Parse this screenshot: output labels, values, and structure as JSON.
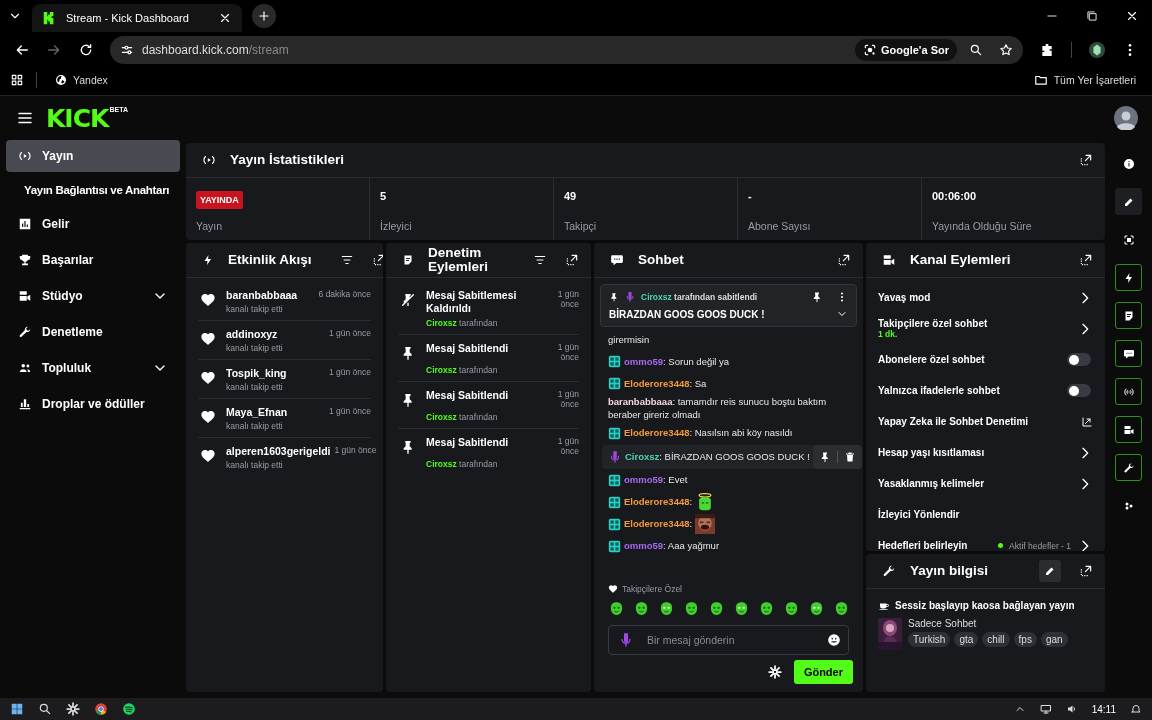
{
  "browser": {
    "tab_title": "Stream - Kick Dashboard",
    "url_host": "dashboard.kick.com",
    "url_path": "/stream",
    "ask_button": "Google'a Sor",
    "bookmarks": [
      "Yandex"
    ],
    "all_bookmarks": "Tüm Yer İşaretleri"
  },
  "header": {
    "logo": "KICK",
    "logo_tag": "BETA"
  },
  "sidebar": {
    "items": [
      {
        "label": "Yayın",
        "selected": true,
        "children": [
          {
            "label": "Yayın Bağlantısı ve Anahtarı",
            "selected": false
          }
        ]
      },
      {
        "label": "Gelir",
        "selected": false
      },
      {
        "label": "Başarılar",
        "selected": false
      },
      {
        "label": "Stüdyo",
        "selected": false,
        "expanded": false
      },
      {
        "label": "Denetleme",
        "selected": false
      },
      {
        "label": "Topluluk",
        "selected": false,
        "expanded": false
      },
      {
        "label": "Droplar ve ödüller",
        "selected": false
      }
    ]
  },
  "stats": {
    "title": "Yayın İstatistikleri",
    "items": [
      {
        "kind": "badge",
        "value": "YAYINDA",
        "label": "Yayın"
      },
      {
        "kind": "number",
        "value": "5",
        "label": "İzleyici"
      },
      {
        "kind": "number",
        "value": "49",
        "label": "Takipçi"
      },
      {
        "kind": "number",
        "value": "-",
        "label": "Abone Sayısı"
      },
      {
        "kind": "number",
        "value": "00:06:00",
        "label": "Yayında Olduğu Süre"
      }
    ]
  },
  "activity": {
    "title": "Etkinlik Akışı",
    "events": [
      {
        "user": "baranbabbaaa",
        "action": "kanalı takip etti",
        "time": "6 dakika önce"
      },
      {
        "user": "addinoxyz",
        "action": "kanalı takip etti",
        "time": "1 gün önce"
      },
      {
        "user": "Tospik_king",
        "action": "kanalı takip etti",
        "time": "1 gün önce"
      },
      {
        "user": "Maya_Efnan",
        "action": "kanalı takip etti",
        "time": "1 gün önce"
      },
      {
        "user": "alperen1603gerigeldi",
        "action": "kanalı takip etti",
        "time": "1 gün önce"
      }
    ]
  },
  "moderation": {
    "title": "Denetim Eylemleri",
    "actions": [
      {
        "kind": "unpin",
        "title": "Mesaj Sabitlemesi Kaldırıldı",
        "moderator": "Ciroxsz",
        "suffix": "tarafından",
        "time": "1 gün önce"
      },
      {
        "kind": "pin",
        "title": "Mesaj Sabitlendi",
        "moderator": "Ciroxsz",
        "suffix": "tarafından",
        "time": "1 gün önce"
      },
      {
        "kind": "pin",
        "title": "Mesaj Sabitlendi",
        "moderator": "Ciroxsz",
        "suffix": "tarafından",
        "time": "1 gün önce"
      },
      {
        "kind": "pin",
        "title": "Mesaj Sabitlendi",
        "moderator": "Ciroxsz",
        "suffix": "tarafından",
        "time": "1 gün önce"
      }
    ]
  },
  "chat": {
    "title": "Sohbet",
    "separator": ":",
    "pinned": {
      "moderator": "Ciroxsz",
      "suffix": "tarafından sabitlendi",
      "text": "BİRAZDAN GOOS GOOS DUCK !"
    },
    "messages": [
      {
        "kind": "continuation",
        "text": "girermisin"
      },
      {
        "kind": "message",
        "user": "ommo59",
        "color": "#a46af0",
        "text": "Sorun değil ya",
        "hovered": false
      },
      {
        "kind": "message",
        "user": "Eloderore3448",
        "color": "#f59a3c",
        "text": "Sa",
        "hovered": false
      },
      {
        "kind": "message",
        "user": "baranbabbaaa",
        "color": "#f2d7df",
        "text": "tamamdır reis sunucu boştu baktım beraber gireriz olmadı",
        "hovered": false
      },
      {
        "kind": "message",
        "user": "Eloderore3448",
        "color": "#f59a3c",
        "text": "Nasılsın abi köy nasıldı",
        "hovered": false
      },
      {
        "kind": "message",
        "user": "Ciroxsz",
        "color": "#49d6b6",
        "text": "BİRAZDAN GOOS GOOS DUCK !",
        "hovered": true
      },
      {
        "kind": "message",
        "user": "ommo59",
        "color": "#a46af0",
        "text": "Evet",
        "hovered": false
      },
      {
        "kind": "emote",
        "user": "Eloderore3448",
        "color": "#f59a3c",
        "hovered": false
      },
      {
        "user": "Eloderore3448",
        "color": "#f59a3c",
        "hovered": false
      },
      {
        "kind": "message",
        "user": "ommo59",
        "color": "#a46af0",
        "text": "Aaa yağmur",
        "hovered": false
      }
    ],
    "emote_label": "Takipçilere Özel",
    "input": {
      "placeholder": "Bir mesaj gönderin"
    },
    "send_button": "Gönder"
  },
  "channel_actions": {
    "title": "Kanal Eylemleri",
    "items": [
      {
        "kind": "link",
        "label": "Yavaş mod"
      },
      {
        "kind": "link",
        "label": "Takipçilere özel sohbet",
        "detail": "1 dk."
      },
      {
        "kind": "toggle",
        "label": "Abonelere özel sohbet",
        "on": false
      },
      {
        "kind": "toggle",
        "label": "Yalnızca ifadelerle sohbet",
        "on": false
      },
      {
        "kind": "external",
        "label": "Yapay Zeka ile Sohbet Denetimi"
      },
      {
        "kind": "link",
        "label": "Hesap yaşı kısıtlaması"
      },
      {
        "kind": "link",
        "label": "Yasaklanmış kelimeler"
      },
      {
        "kind": "plain",
        "label": "İzleyici Yönlendir"
      },
      {
        "kind": "goals",
        "label": "Hedefleri belirleyin",
        "detail": "Aktif hedefler - 1"
      }
    ]
  },
  "stream_info": {
    "title": "Yayın bilgisi",
    "description": "Sessiz başlayıp kaosa bağlayan yayın",
    "category": "Sadece Sohbet",
    "tags": [
      "Turkish",
      "gta",
      "chill",
      "fps",
      "gan"
    ]
  },
  "rail": [
    {
      "selected": false,
      "enabled": false
    },
    {
      "selected": true,
      "enabled": false
    },
    {
      "selected": false,
      "enabled": false
    },
    {
      "selected": false,
      "enabled": true
    },
    {
      "selected": false,
      "enabled": true
    },
    {
      "selected": false,
      "enabled": true
    },
    {
      "selected": false,
      "enabled": true
    },
    {
      "selected": false,
      "enabled": true
    },
    {
      "selected": false,
      "enabled": true
    },
    {
      "selected": false,
      "enabled": false
    }
  ],
  "taskbar": {
    "time": "14:11"
  }
}
